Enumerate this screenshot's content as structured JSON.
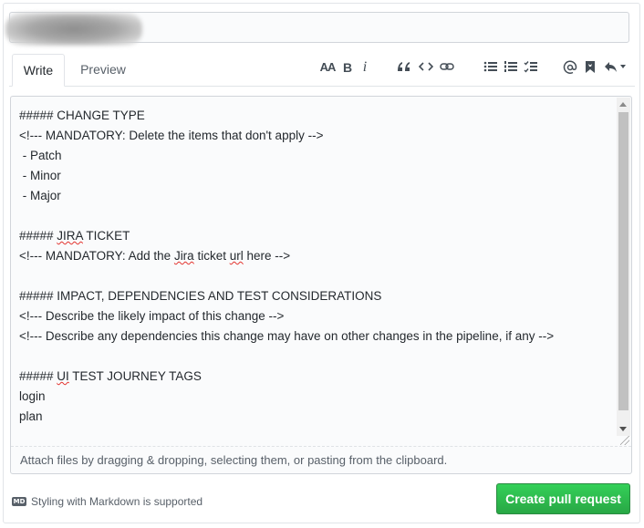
{
  "title_field": {
    "value": ""
  },
  "tabs": {
    "write": "Write",
    "preview": "Preview"
  },
  "toolbar": {
    "heading": "AA",
    "bold": "B",
    "italic": "i",
    "icons": [
      "text-size-icon",
      "bold-icon",
      "italic-icon",
      "quote-icon",
      "code-icon",
      "link-icon",
      "unordered-list-icon",
      "ordered-list-icon",
      "task-list-icon",
      "mention-icon",
      "bookmark-icon",
      "reply-icon"
    ]
  },
  "editor": {
    "lines": [
      "##### CHANGE TYPE",
      "<!--- MANDATORY: Delete the items that don't apply -->",
      " - Patch",
      " - Minor",
      " - Major",
      "",
      "##### JIRA TICKET",
      "<!--- MANDATORY: Add the Jira ticket url here -->",
      "",
      "##### IMPACT, DEPENDENCIES AND TEST CONSIDERATIONS",
      "<!--- Describe the likely impact of this change -->",
      "<!--- Describe any dependencies this change may have on other changes in the pipeline, if any -->",
      "",
      "##### UI TEST JOURNEY TAGS",
      "login",
      "plan"
    ],
    "attach_text": "Attach files by dragging & dropping, selecting them, or pasting from the clipboard."
  },
  "footer": {
    "markdown_icon": "MD",
    "markdown_note": "Styling with Markdown is supported",
    "create_button": "Create pull request"
  },
  "colors": {
    "primary_button": "#2ea44f",
    "border": "#e1e4e8",
    "muted_text": "#586069"
  }
}
